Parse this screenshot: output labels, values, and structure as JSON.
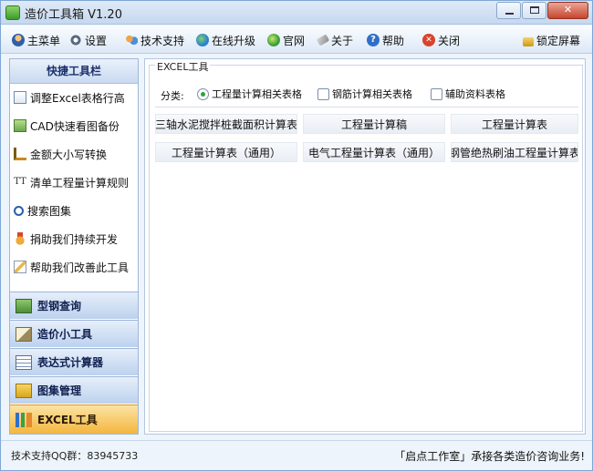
{
  "window": {
    "title": "造价工具箱 V1.20"
  },
  "menubar": {
    "items": [
      {
        "label": "主菜单",
        "icon": "user-icon"
      },
      {
        "label": "设置",
        "icon": "settings-icon"
      },
      {
        "label": "技术支持",
        "icon": "support-icon"
      },
      {
        "label": "在线升级",
        "icon": "globe-icon"
      },
      {
        "label": "官网",
        "icon": "website-icon"
      },
      {
        "label": "关于",
        "icon": "tag-icon"
      },
      {
        "label": "帮助",
        "icon": "help-icon"
      },
      {
        "label": "关闭",
        "icon": "close-circle-icon"
      }
    ],
    "lock": {
      "label": "锁定屏幕",
      "icon": "lock-icon"
    }
  },
  "sidebar": {
    "header": "快捷工具栏",
    "items": [
      {
        "label": "调整Excel表格行高",
        "icon": "document-icon"
      },
      {
        "label": "CAD快速看图备份",
        "icon": "cad-icon"
      },
      {
        "label": "金额大小写转换",
        "icon": "ruler-icon"
      },
      {
        "label": "清单工程量计算规则",
        "icon": "text-icon"
      },
      {
        "label": "搜索图集",
        "icon": "search-icon"
      },
      {
        "label": "捐助我们持续开发",
        "icon": "medal-icon"
      },
      {
        "label": "帮助我们改善此工具",
        "icon": "pencil-icon"
      }
    ],
    "sections": [
      {
        "label": "型钢查询",
        "icon": "steel-icon",
        "active": false
      },
      {
        "label": "造价小工具",
        "icon": "tools-icon",
        "active": false
      },
      {
        "label": "表达式计算器",
        "icon": "table-icon",
        "active": false
      },
      {
        "label": "图集管理",
        "icon": "atlas-icon",
        "active": false
      },
      {
        "label": "EXCEL工具",
        "icon": "excel-chart-icon",
        "active": true
      }
    ]
  },
  "main": {
    "group_label": "EXCEL工具",
    "category_label": "分类:",
    "categories": [
      {
        "label": "工程量计算相关表格",
        "type": "radio",
        "selected": true
      },
      {
        "label": "钢筋计算相关表格",
        "type": "checkbox",
        "selected": false
      },
      {
        "label": "辅助资料表格",
        "type": "checkbox",
        "selected": false
      }
    ],
    "tools": [
      "三轴水泥搅拌桩截面积计算表",
      "工程量计算稿",
      "工程量计算表",
      "工程量计算表（通用）",
      "电气工程量计算表（通用）",
      "钢管绝热刷油工程量计算表"
    ]
  },
  "statusbar": {
    "left": "技术支持QQ群：83945733",
    "right": "「启点工作室」承接各类造价咨询业务!"
  }
}
